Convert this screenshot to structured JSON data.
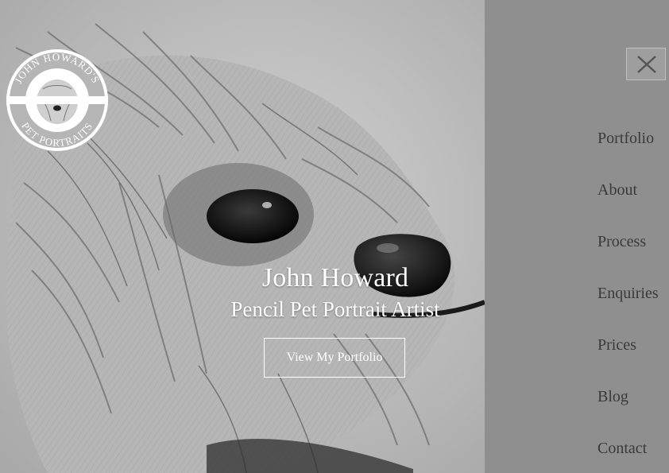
{
  "logo": {
    "top_text": "JOHN HOWARD'S",
    "bottom_text": "PET PORTRAITS"
  },
  "hero": {
    "name": "John Howard",
    "subtitle": "Pencil Pet Portrait Artist",
    "cta_label": "View My Portfolio"
  },
  "menu": {
    "close_icon": "close-icon",
    "items": [
      {
        "label": "Portfolio"
      },
      {
        "label": "About"
      },
      {
        "label": "Process"
      },
      {
        "label": "Enquiries"
      },
      {
        "label": "Prices"
      },
      {
        "label": "Blog"
      },
      {
        "label": "Contact"
      }
    ]
  },
  "colors": {
    "menu_bg": "#8f8f8f",
    "menu_text": "#3a3a3a",
    "hero_text": "#ffffff"
  }
}
